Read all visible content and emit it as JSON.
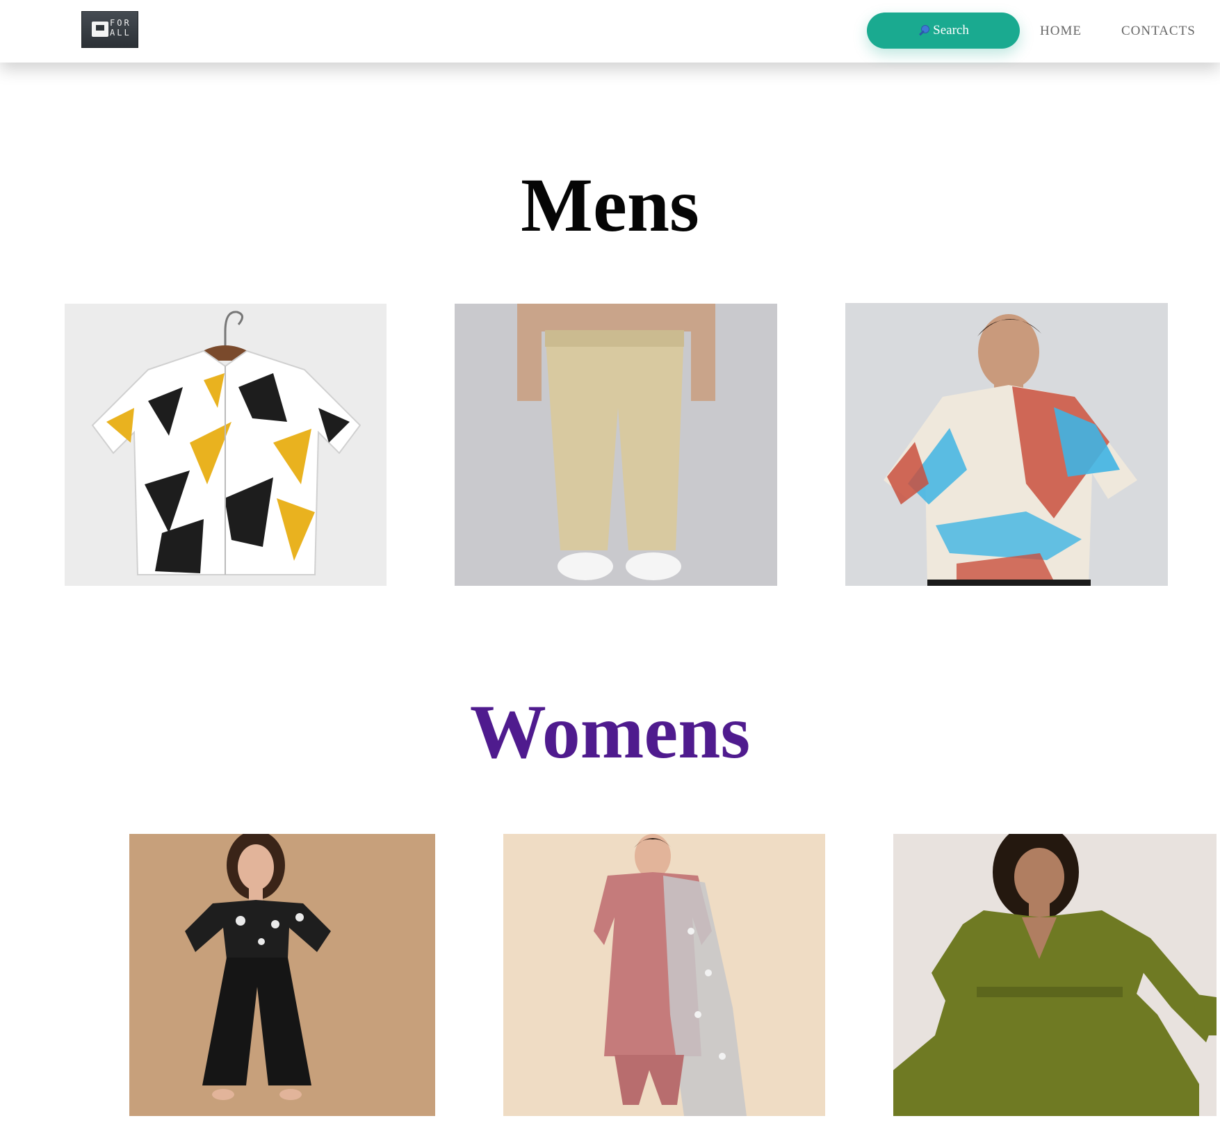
{
  "header": {
    "logo_text": "FOR ALL",
    "search_label": "Search",
    "search_icon": "magnifier-icon",
    "nav": [
      {
        "label": "HOME"
      },
      {
        "label": "CONTACTS"
      }
    ]
  },
  "sections": {
    "mens": {
      "title": "Mens",
      "products": [
        {
          "image": "printed-shirt"
        },
        {
          "image": "khaki-trousers"
        },
        {
          "image": "tie-dye-tshirt"
        }
      ]
    },
    "womens": {
      "title": "Womens",
      "title_color": "#4f1b8e",
      "products": [
        {
          "image": "black-jumpsuit"
        },
        {
          "image": "pink-kurta-set"
        },
        {
          "image": "olive-dress"
        }
      ]
    }
  },
  "colors": {
    "accent": "#1aaa90",
    "nav_text": "#666666"
  }
}
